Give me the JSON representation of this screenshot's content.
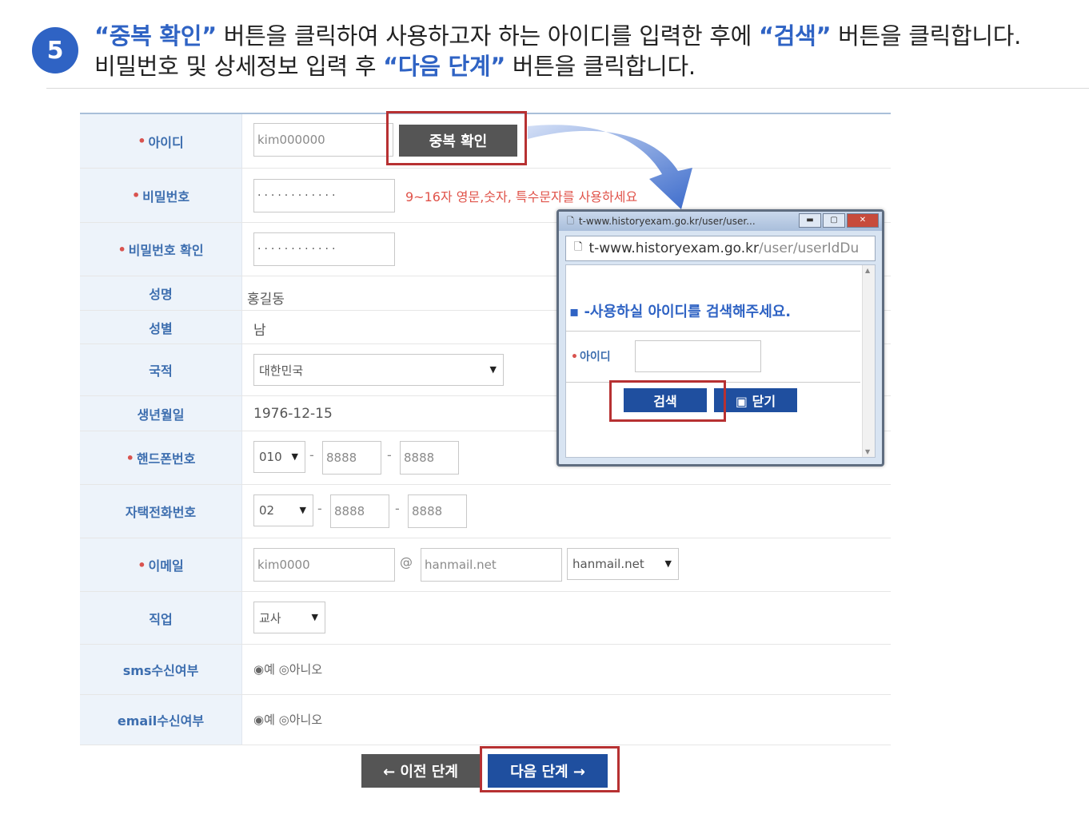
{
  "header": {
    "step": "5",
    "line1": [
      {
        "text": "“중복 확인”",
        "hl": true
      },
      {
        "text": " 버튼을 클릭하여 사용하고자 하는 아이디를 입력한 후에 ",
        "hl": false
      },
      {
        "text": "“검색”",
        "hl": true
      },
      {
        "text": " 버튼을 클릭합니다.",
        "hl": false
      }
    ],
    "line2": [
      {
        "text": "비밀번호 및 상세정보 입력 후 ",
        "hl": false
      },
      {
        "text": "“다음 단계”",
        "hl": true
      },
      {
        "text": " 버튼을 클릭합니다.",
        "hl": false
      }
    ]
  },
  "form": {
    "id": {
      "label": "아이디",
      "value": "kim000000",
      "check_button": "중복 확인"
    },
    "password": {
      "label": "비밀번호",
      "value": "············",
      "hint": "9~16자 영문,숫자, 특수문자를 사용하세요"
    },
    "password_confirm": {
      "label": "비밀번호 확인",
      "value": "············"
    },
    "name": {
      "label": "성명",
      "value": "홍길동"
    },
    "gender": {
      "label": "성별",
      "value": "남"
    },
    "nationality": {
      "label": "국적",
      "value": "대한민국"
    },
    "birthdate": {
      "label": "생년월일",
      "value": "1976-12-15"
    },
    "mobile": {
      "label": "핸드폰번호",
      "prefix": "010",
      "mid": "8888",
      "last": "8888",
      "sep": "-"
    },
    "home_phone": {
      "label": "자택전화번호",
      "prefix": "02",
      "mid": "8888",
      "last": "8888",
      "sep": "-"
    },
    "email": {
      "label": "이메일",
      "local": "kim0000",
      "at": "@",
      "domain": "hanmail.net",
      "domain_select": "hanmail.net"
    },
    "job": {
      "label": "직업",
      "value": "교사"
    },
    "sms": {
      "label": "sms수신여부",
      "options": "◉예 ◎아니오"
    },
    "email_receive": {
      "label": "email수신여부",
      "options": "◉예 ◎아니오"
    }
  },
  "buttons": {
    "prev": "← 이전 단계",
    "next": "다음 단계 →"
  },
  "popup": {
    "title": "t-www.historyexam.go.kr/user/user...",
    "url_main": "t-www.historyexam.go.kr",
    "url_sub": "/user/userIdDu",
    "message": "▪ -사용하실 아이디를 검색해주세요.",
    "id_label": "아이디",
    "search_button": "검색",
    "close_button": "▣ 닫기"
  },
  "colors": {
    "accent": "#2f63c4",
    "red_highlight": "#b73132",
    "label_bg": "#edf3fa",
    "button_blue": "#1f4f9f"
  }
}
